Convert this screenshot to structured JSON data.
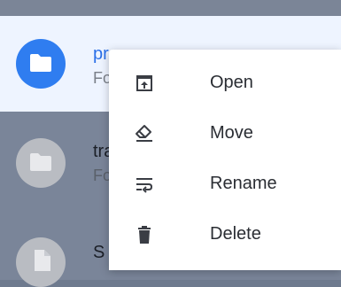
{
  "files": [
    {
      "name": "program",
      "subtitle": "Fo",
      "icon": "folder-icon"
    },
    {
      "name": "tra",
      "subtitle": "Fo",
      "icon": "folder-icon"
    },
    {
      "name": "S",
      "icon": "file-icon"
    }
  ],
  "context_menu": {
    "items": [
      {
        "label": "Open",
        "icon": "open-icon"
      },
      {
        "label": "Move",
        "icon": "move-icon"
      },
      {
        "label": "Rename",
        "icon": "rename-icon"
      },
      {
        "label": "Delete",
        "icon": "delete-icon"
      }
    ]
  },
  "colors": {
    "accent": "#2f7df0",
    "selected_bg": "#eef4ff",
    "scrim": "#7a8599"
  }
}
